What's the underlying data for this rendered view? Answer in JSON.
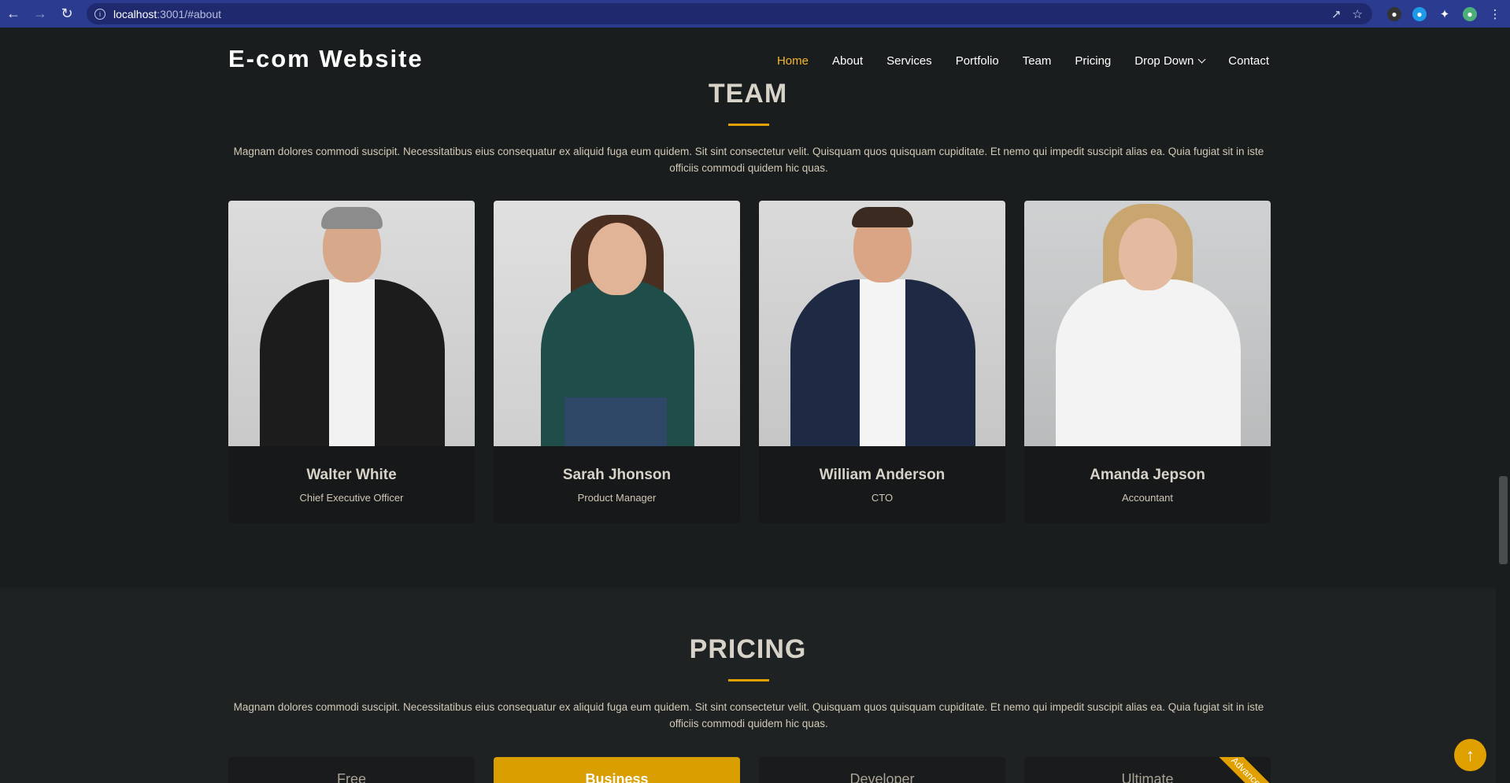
{
  "browser": {
    "url_host": "localhost",
    "url_rest": ":3001/#about"
  },
  "header": {
    "logo": "E-com Website",
    "menu": [
      "Home",
      "About",
      "Services",
      "Portfolio",
      "Team",
      "Pricing",
      "Drop Down",
      "Contact"
    ]
  },
  "team": {
    "title": "TEAM",
    "description": "Magnam dolores commodi suscipit. Necessitatibus eius consequatur ex aliquid fuga eum quidem. Sit sint consectetur velit. Quisquam quos quisquam cupiditate. Et nemo qui impedit suscipit alias ea. Quia fugiat sit in iste officiis commodi quidem hic quas.",
    "members": [
      {
        "name": "Walter White",
        "role": "Chief Executive Officer"
      },
      {
        "name": "Sarah Jhonson",
        "role": "Product Manager"
      },
      {
        "name": "William Anderson",
        "role": "CTO"
      },
      {
        "name": "Amanda Jepson",
        "role": "Accountant"
      }
    ]
  },
  "pricing": {
    "title": "PRICING",
    "description": "Magnam dolores commodi suscipit. Necessitatibus eius consequatur ex aliquid fuga eum quidem. Sit sint consectetur velit. Quisquam quos quisquam cupiditate. Et nemo qui impedit suscipit alias ea. Quia fugiat sit in iste officiis commodi quidem hic quas.",
    "plans": [
      "Free",
      "Business",
      "Developer",
      "Ultimate"
    ],
    "ribbon": "Advanced"
  },
  "colors": {
    "accent": "#e0a000",
    "active_link": "#f5b72b",
    "background": "#1a1d1e",
    "browser_chrome": "#2b3b8f"
  },
  "icons": {
    "back_to_top": "arrow-up-icon"
  }
}
